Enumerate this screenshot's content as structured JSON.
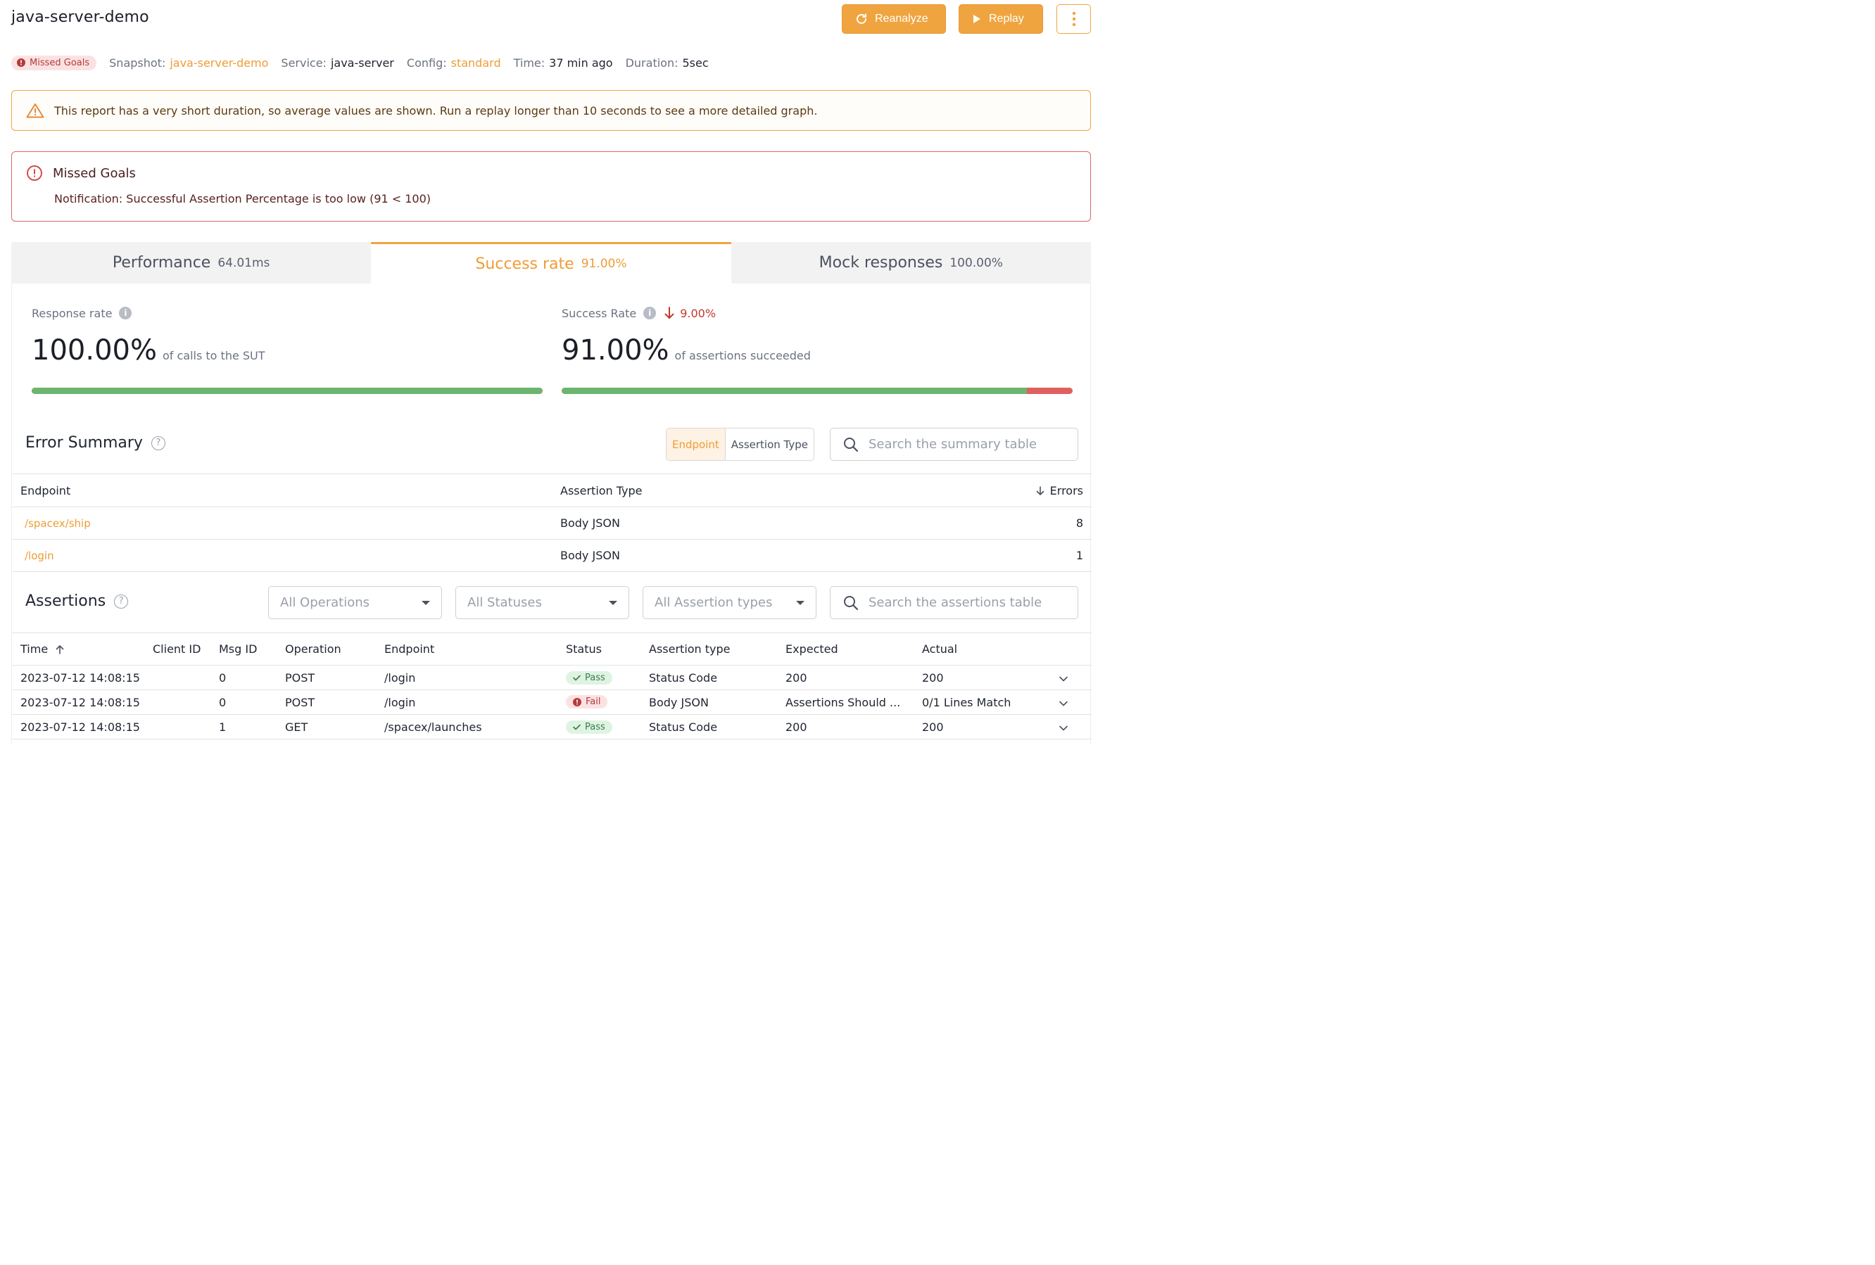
{
  "title": "java-server-demo",
  "header": {
    "reanalyze_label": "Reanalyze",
    "replay_label": "Replay"
  },
  "meta": {
    "badge": "Missed Goals",
    "snapshot_label": "Snapshot:",
    "snapshot": "java-server-demo",
    "service_label": "Service:",
    "service": "java-server",
    "config_label": "Config:",
    "config": "standard",
    "time_label": "Time:",
    "time": "37 min ago",
    "duration_label": "Duration:",
    "duration": "5sec"
  },
  "warning": "This report has a very short duration, so average values are shown. Run a replay longer than 10 seconds to see a more detailed graph.",
  "missed_goals": {
    "title": "Missed Goals",
    "message": "Notification: Successful Assertion Percentage is too low (91 < 100)"
  },
  "tabs": [
    {
      "label": "Performance",
      "value": "64.01ms"
    },
    {
      "label": "Success rate",
      "value": "91.00%"
    },
    {
      "label": "Mock responses",
      "value": "100.00%"
    }
  ],
  "response_rate": {
    "label": "Response rate",
    "value": "100.00%",
    "desc": "of calls to the SUT",
    "bar_fraction": 1.0
  },
  "success_rate": {
    "label": "Success Rate",
    "delta": "9.00%",
    "value": "91.00%",
    "desc": "of assertions succeeded",
    "bar_fraction": 0.91
  },
  "error_summary": {
    "title": "Error Summary",
    "toggle": [
      "Endpoint",
      "Assertion Type"
    ],
    "search_placeholder": "Search the summary table",
    "columns": [
      "Endpoint",
      "Assertion Type",
      "Errors"
    ],
    "rows": [
      {
        "endpoint": "/spacex/ship",
        "assertion_type": "Body JSON",
        "errors": "8"
      },
      {
        "endpoint": "/login",
        "assertion_type": "Body JSON",
        "errors": "1"
      }
    ]
  },
  "assertions": {
    "title": "Assertions",
    "filters": [
      "All Operations",
      "All Statuses",
      "All Assertion types"
    ],
    "search_placeholder": "Search the assertions table",
    "columns": [
      "Time",
      "Client ID",
      "Msg ID",
      "Operation",
      "Endpoint",
      "Status",
      "Assertion type",
      "Expected",
      "Actual"
    ],
    "rows": [
      {
        "time": "2023-07-12 14:08:15",
        "client_id": "",
        "msg_id": "0",
        "operation": "POST",
        "endpoint": "/login",
        "status": "Pass",
        "assertion_type": "Status Code",
        "expected": "200",
        "actual": "200"
      },
      {
        "time": "2023-07-12 14:08:15",
        "client_id": "",
        "msg_id": "0",
        "operation": "POST",
        "endpoint": "/login",
        "status": "Fail",
        "assertion_type": "Body JSON",
        "expected": "Assertions Should ...",
        "actual": "0/1 Lines Match"
      },
      {
        "time": "2023-07-12 14:08:15",
        "client_id": "",
        "msg_id": "1",
        "operation": "GET",
        "endpoint": "/spacex/launches",
        "status": "Pass",
        "assertion_type": "Status Code",
        "expected": "200",
        "actual": "200"
      }
    ]
  },
  "colors": {
    "accent": "#f0a43f",
    "success": "#6cb56f",
    "danger": "#e06060"
  }
}
